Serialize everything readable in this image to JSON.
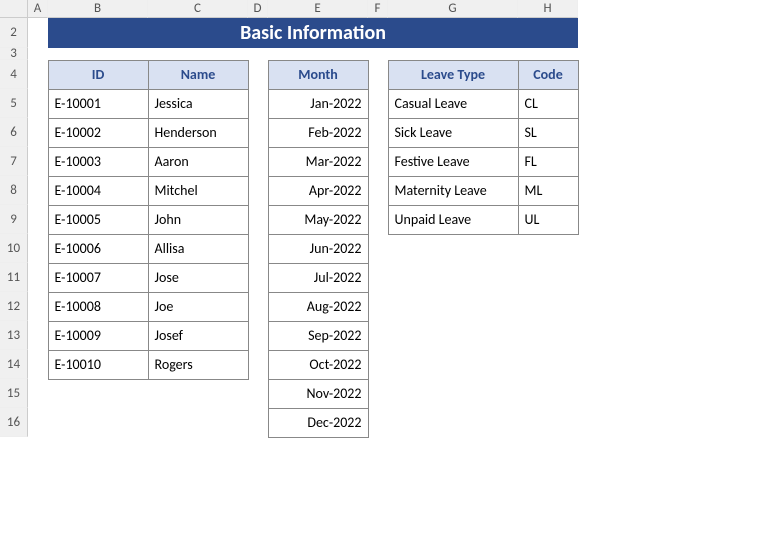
{
  "title": "Basic Information",
  "columns": [
    "A",
    "B",
    "C",
    "D",
    "E",
    "F",
    "G",
    "H"
  ],
  "rows": [
    "2",
    "3",
    "4",
    "5",
    "6",
    "7",
    "8",
    "9",
    "10",
    "11",
    "12",
    "13",
    "14",
    "15",
    "16"
  ],
  "table1": {
    "headers": [
      "ID",
      "Name"
    ],
    "rows": [
      [
        "E-10001",
        "Jessica"
      ],
      [
        "E-10002",
        "Henderson"
      ],
      [
        "E-10003",
        "Aaron"
      ],
      [
        "E-10004",
        "Mitchel"
      ],
      [
        "E-10005",
        "John"
      ],
      [
        "E-10006",
        "Allisa"
      ],
      [
        "E-10007",
        "Jose"
      ],
      [
        "E-10008",
        "Joe"
      ],
      [
        "E-10009",
        "Josef"
      ],
      [
        "E-10010",
        "Rogers"
      ]
    ]
  },
  "table2": {
    "header": "Month",
    "rows": [
      "Jan-2022",
      "Feb-2022",
      "Mar-2022",
      "Apr-2022",
      "May-2022",
      "Jun-2022",
      "Jul-2022",
      "Aug-2022",
      "Sep-2022",
      "Oct-2022",
      "Nov-2022",
      "Dec-2022"
    ]
  },
  "table3": {
    "headers": [
      "Leave Type",
      "Code"
    ],
    "rows": [
      [
        "Casual Leave",
        "CL"
      ],
      [
        "Sick Leave",
        "SL"
      ],
      [
        "Festive Leave",
        "FL"
      ],
      [
        "Maternity Leave",
        "ML"
      ],
      [
        "Unpaid Leave",
        "UL"
      ]
    ]
  }
}
